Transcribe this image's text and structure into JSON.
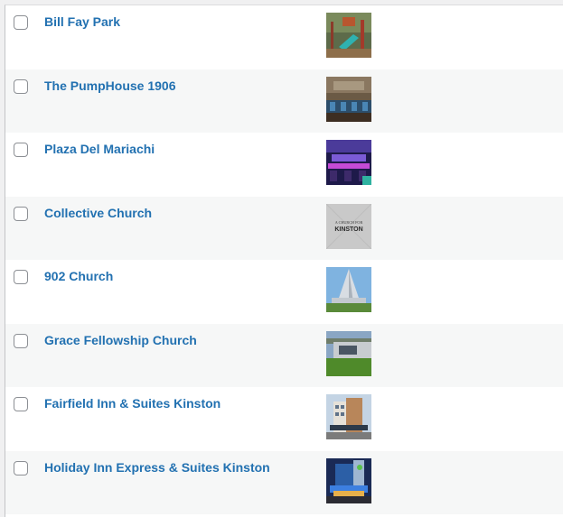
{
  "rows": [
    {
      "title": "Bill Fay Park",
      "thumbnail": "playground-photo"
    },
    {
      "title": "The PumpHouse 1906",
      "thumbnail": "restaurant-interior-photo"
    },
    {
      "title": "Plaza Del Mariachi",
      "thumbnail": "neon-bar-photo"
    },
    {
      "title": "Collective Church",
      "thumbnail": "church-logo-image"
    },
    {
      "title": "902 Church",
      "thumbnail": "church-building-photo"
    },
    {
      "title": "Grace Fellowship Church",
      "thumbnail": "church-lawn-photo"
    },
    {
      "title": "Fairfield Inn & Suites Kinston",
      "thumbnail": "hotel-building-photo"
    },
    {
      "title": "Holiday Inn Express & Suites Kinston",
      "thumbnail": "hotel-night-photo"
    }
  ],
  "logo_text": {
    "line1": "A CHURCH FOR",
    "line2": "KINSTON"
  }
}
